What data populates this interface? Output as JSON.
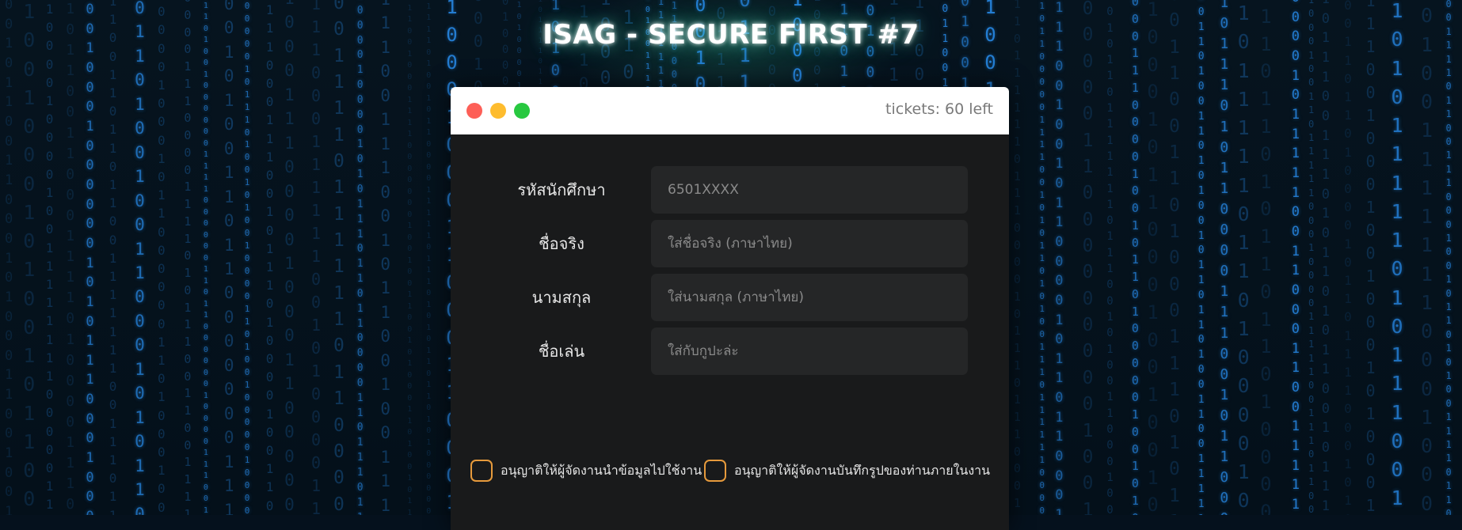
{
  "page": {
    "title": "ISAG - SECURE FIRST #7"
  },
  "window": {
    "tickets_label": "tickets: 60 left",
    "controls": [
      "close-dot",
      "minimize-dot",
      "maximize-dot"
    ]
  },
  "form": {
    "fields": [
      {
        "label": "รหัสนักศึกษา",
        "placeholder": "6501XXXX",
        "value": ""
      },
      {
        "label": "ชื่อจริง",
        "placeholder": "ใส่ชื่อจริง (ภาษาไทย)",
        "value": ""
      },
      {
        "label": "นามสกุล",
        "placeholder": "ใส่นามสกุล (ภาษาไทย)",
        "value": ""
      },
      {
        "label": "ชื่อเล่น",
        "placeholder": "ใส่กับกูปะล่ะ",
        "value": ""
      }
    ],
    "consents": [
      {
        "label": "อนุญาติให้ผู้จัดงานนำข้อมูลไปใช้งาน",
        "checked": false
      },
      {
        "label": "อนุญาติให้ผู้จัดงานบันทึกรูปของท่านภายในงาน",
        "checked": false
      }
    ]
  },
  "colors": {
    "background": "#05111d",
    "matrix_digits": "#1f7fd6",
    "window_body": "#191a1b",
    "input_bg": "#252627",
    "checkbox_border": "#e69a3c",
    "close": "#fd5f57",
    "minimize": "#febc2e",
    "maximize": "#28c840"
  }
}
